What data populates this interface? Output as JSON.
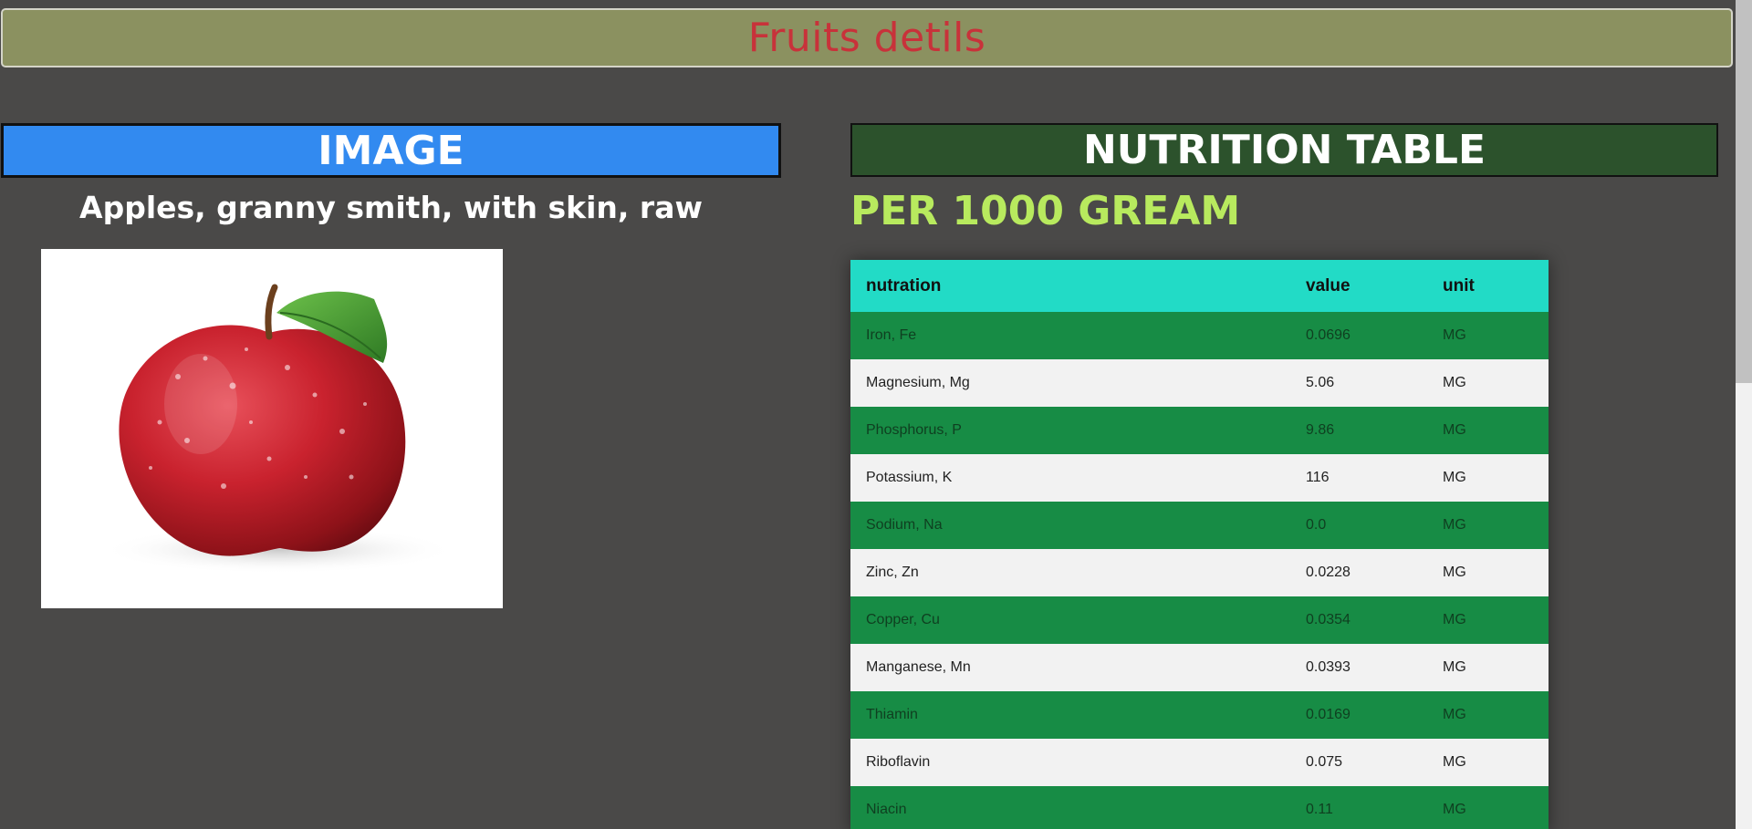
{
  "header": {
    "title": "Fruits detils"
  },
  "image_section": {
    "title": "IMAGE",
    "fruit_name": "Apples, granny smith, with skin, raw"
  },
  "nutrition_section": {
    "title": "NUTRITION TABLE",
    "per_label": "PER 1000 GREAM",
    "columns": [
      "nutration",
      "value",
      "unit"
    ],
    "rows": [
      {
        "name": "Iron, Fe",
        "value": "0.0696",
        "unit": "MG"
      },
      {
        "name": "Magnesium, Mg",
        "value": "5.06",
        "unit": "MG"
      },
      {
        "name": "Phosphorus, P",
        "value": "9.86",
        "unit": "MG"
      },
      {
        "name": "Potassium, K",
        "value": "116",
        "unit": "MG"
      },
      {
        "name": "Sodium, Na",
        "value": "0.0",
        "unit": "MG"
      },
      {
        "name": "Zinc, Zn",
        "value": "0.0228",
        "unit": "MG"
      },
      {
        "name": "Copper, Cu",
        "value": "0.0354",
        "unit": "MG"
      },
      {
        "name": "Manganese, Mn",
        "value": "0.0393",
        "unit": "MG"
      },
      {
        "name": "Thiamin",
        "value": "0.0169",
        "unit": "MG"
      },
      {
        "name": "Riboflavin",
        "value": "0.075",
        "unit": "MG"
      },
      {
        "name": "Niacin",
        "value": "0.11",
        "unit": "MG"
      }
    ]
  },
  "colors": {
    "header_bg": "#8b9160",
    "header_text": "#c8323a",
    "image_bar": "#328af0",
    "nutrition_bar": "#2c522c",
    "per_label": "#b8ea5e",
    "table_head": "#22dbc6",
    "row_green": "#178c45",
    "row_light": "#f2f2f2"
  }
}
